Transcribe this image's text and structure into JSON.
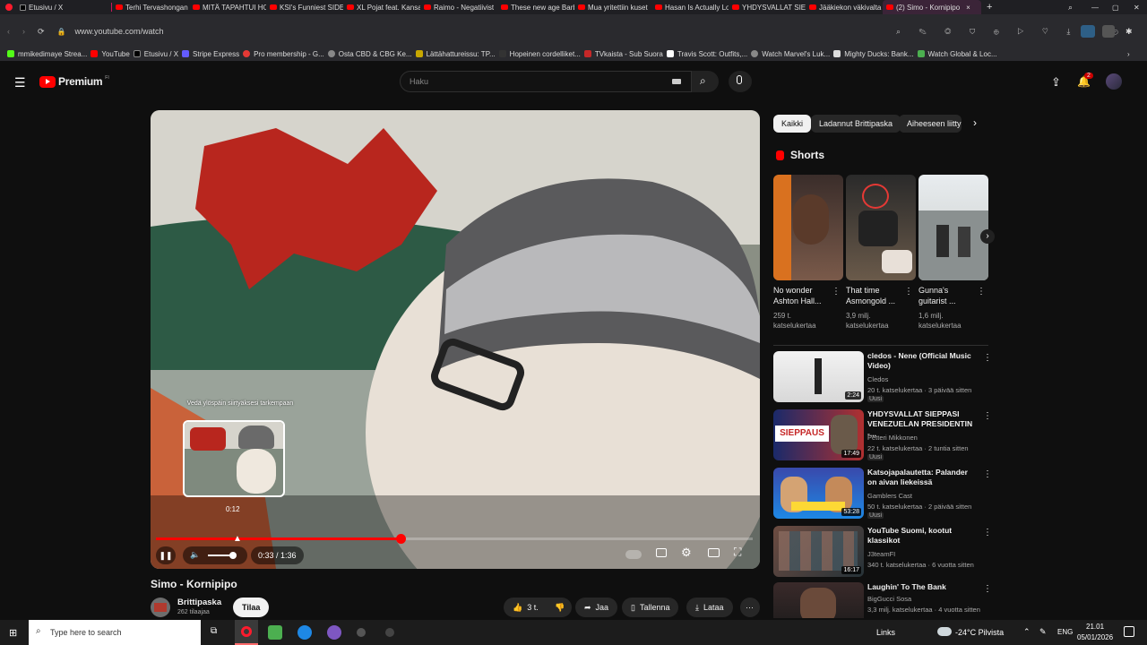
{
  "browser": {
    "tabs": [
      {
        "label": "Etusivu / X",
        "icon": "x-logo-icon",
        "active": false
      },
      {
        "label": "Terhi Tervashongan",
        "icon": "youtube-icon",
        "active": false
      },
      {
        "label": "MITÄ TAPAHTUI HO",
        "icon": "youtube-icon",
        "active": false
      },
      {
        "label": "KSI's Funniest SIDEM",
        "icon": "youtube-icon",
        "active": false
      },
      {
        "label": "XL Pojat feat. Kansa",
        "icon": "youtube-icon",
        "active": false
      },
      {
        "label": "Raimo - Negatiivist",
        "icon": "youtube-icon",
        "active": false
      },
      {
        "label": "These new age Barb",
        "icon": "youtube-icon",
        "active": false
      },
      {
        "label": "Mua yritettiin kuset",
        "icon": "youtube-icon",
        "active": false
      },
      {
        "label": "Hasan Is Actually Lo",
        "icon": "youtube-icon",
        "active": false
      },
      {
        "label": "YHDYSVALLAT SIEP",
        "icon": "youtube-icon",
        "active": false
      },
      {
        "label": "Jääkiekon väkivalta",
        "icon": "youtube-icon",
        "active": false
      },
      {
        "label": "(2) Simo - Kornipipo",
        "icon": "youtube-icon",
        "active": true
      }
    ],
    "url": "www.youtube.com/watch",
    "bookmarks": [
      {
        "label": "mmikedimaye Strea...",
        "icon": "bookmark-icon"
      },
      {
        "label": "YouTube",
        "icon": "youtube-icon"
      },
      {
        "label": "Etusivu / X",
        "icon": "x-logo-icon"
      },
      {
        "label": "Stripe Express",
        "icon": "stripe-icon"
      },
      {
        "label": "Pro membership - G...",
        "icon": "pin-icon"
      },
      {
        "label": "Osta CBD & CBG Ke...",
        "icon": "globe-icon"
      },
      {
        "label": "Lättähattureissu: TP...",
        "icon": "bookmark-icon"
      },
      {
        "label": "Hopeinen cordelliket...",
        "icon": "nt-icon"
      },
      {
        "label": "TVkaista - Sub Suora",
        "icon": "tv-icon"
      },
      {
        "label": "Travis Scott: Outfits,...",
        "icon": "w-icon"
      },
      {
        "label": "Watch Marvel's Luk...",
        "icon": "globe-icon"
      },
      {
        "label": "Mighty Ducks: Bank...",
        "icon": "bookmark-icon"
      },
      {
        "label": "Watch Global & Loc...",
        "icon": "bookmark-icon"
      }
    ]
  },
  "yt": {
    "logo": "Premium",
    "logo_badge": "FI",
    "search_placeholder": "Haku",
    "notif_count": "2"
  },
  "player": {
    "preview_hint": "Vedä ylöspäin siirtyäksesi tarkempaan",
    "preview_time": "0:12",
    "time": "0:33 / 1:36",
    "progress": 0.41
  },
  "video": {
    "title": "Simo - Kornipipo",
    "channel": "Brittipaska",
    "subs": "262 tilaajaa",
    "subscribe": "Tilaa",
    "likes": "3 t.",
    "share": "Jaa",
    "save": "Tallenna",
    "download": "Lataa"
  },
  "chips": [
    {
      "label": "Kaikki",
      "selected": true
    },
    {
      "label": "Ladannut Brittipaska",
      "selected": false
    },
    {
      "label": "Aiheeseen liitty",
      "selected": false
    }
  ],
  "shorts_heading": "Shorts",
  "shorts": [
    {
      "title": "No wonder Ashton Hall...",
      "views": "259 t. katselukertaa"
    },
    {
      "title": "That time Asmongold ...",
      "views": "3,9 milj. katselukertaa"
    },
    {
      "title": "Gunna's guitarist ...",
      "views": "1,6 milj. katselukertaa"
    }
  ],
  "recs": [
    {
      "title": "cledos - Nene (Official Music Video)",
      "channel": "Cledos",
      "meta": "20 t. katselukertaa · 3 päivää sitten",
      "badge": "Uusi",
      "duration": "2:24"
    },
    {
      "title": "YHDYSVALLAT SIEPPASI VENEZUELAN PRESIDENTIN -...",
      "channel": "Petteri Mikkonen",
      "meta": "22 t. katselukertaa · 2 tuntia sitten",
      "badge": "Uusi",
      "duration": "17:49"
    },
    {
      "title": "Katsojapalautetta: Palander on aivan liekeissä",
      "channel": "Gamblers Cast",
      "meta": "50 t. katselukertaa · 2 päivää sitten",
      "badge": "Uusi",
      "duration": "53:28"
    },
    {
      "title": "YouTube Suomi, kootut klassikot",
      "channel": "J3teamFI",
      "meta": "340 t. katselukertaa · 6 vuotta sitten",
      "badge": "",
      "duration": "16:17"
    },
    {
      "title": "Laughin' To The Bank",
      "channel": "BigGucci Sosa",
      "meta": "3,3 milj. katselukertaa · 4 vuotta sitten",
      "badge": "",
      "duration": ""
    }
  ],
  "taskbar": {
    "search_placeholder": "Type here to search",
    "links": "Links",
    "weather": "-24°C Pilvista",
    "lang": "ENG",
    "time": "21.01",
    "date": "05/01/2026"
  }
}
